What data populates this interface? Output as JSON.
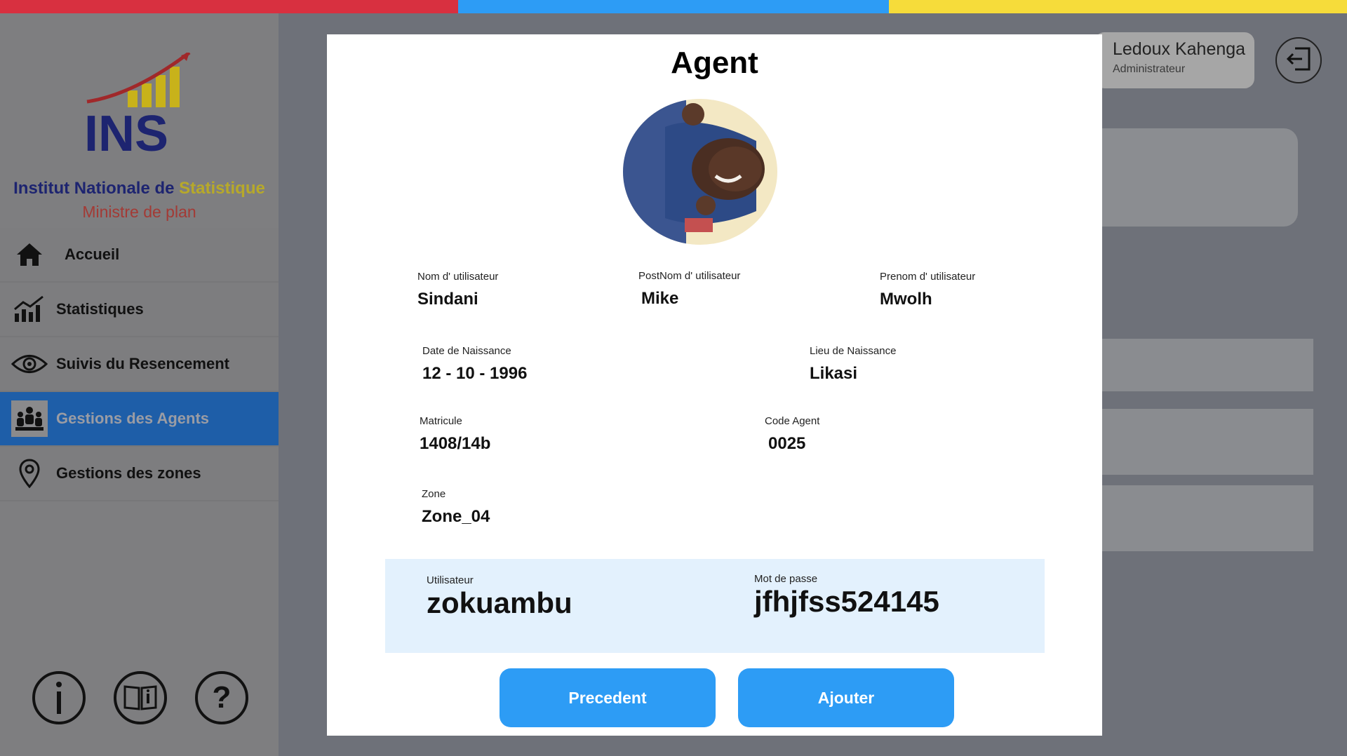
{
  "colors": {
    "red": "#d83040",
    "blue": "#2d9cf5",
    "yellow": "#f6dc3a",
    "active_nav": "#1e5ea8",
    "cred_bg": "#e3f1fd"
  },
  "brand": {
    "logo_text": "INS",
    "name_part1": "Institut Nationale de ",
    "name_part2": "Statistique",
    "ministry": "Ministre de plan"
  },
  "sidebar": {
    "items": [
      {
        "label": "Accueil",
        "icon": "home-icon"
      },
      {
        "label": "Statistiques",
        "icon": "chart-icon"
      },
      {
        "label": "Suivis du Resencement",
        "icon": "eye-icon"
      },
      {
        "label": "Gestions des Agents",
        "icon": "people-icon",
        "active": true
      },
      {
        "label": "Gestions des zones",
        "icon": "location-pin-icon"
      }
    ],
    "bottom_icons": [
      "info-icon",
      "book-icon",
      "help-icon"
    ]
  },
  "header": {
    "user_name": "Ledoux Kahenga",
    "user_role": "Administrateur",
    "logout_icon": "logout-icon"
  },
  "modal": {
    "title": "Agent",
    "fields": {
      "nom_label": "Nom d' utilisateur",
      "nom_value": "Sindani",
      "postnom_label": "PostNom d' utilisateur",
      "postnom_value": "Mike",
      "prenom_label": "Prenom d' utilisateur",
      "prenom_value": "Mwolh",
      "dob_label": "Date de Naissance",
      "dob_value": "12 - 10 - 1996",
      "lieu_label": "Lieu de Naissance",
      "lieu_value": "Likasi",
      "matricule_label": "Matricule",
      "matricule_value": "1408/14b",
      "code_label": "Code Agent",
      "code_value": "0025",
      "zone_label": "Zone",
      "zone_value": "Zone_04"
    },
    "credentials": {
      "user_label": "Utilisateur",
      "user_value": "zokuambu",
      "pass_label": "Mot de passe",
      "pass_value": "jfhjfss524145"
    },
    "buttons": {
      "prev": "Precedent",
      "add": "Ajouter"
    }
  }
}
